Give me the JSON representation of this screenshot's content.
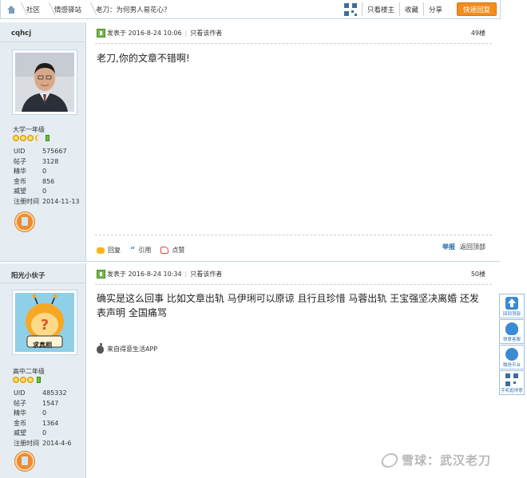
{
  "breadcrumb": {
    "items": [
      "社区",
      "情感驿站",
      "老刀：为何男人易花心？"
    ]
  },
  "toolbar": {
    "only_host": "只看楼主",
    "favorite": "收藏",
    "share": "分享",
    "quick_reply": "快速回复"
  },
  "posts": [
    {
      "username": "cqhcj",
      "level": "大学一年级",
      "stats": [
        {
          "k": "UID",
          "v": "575667"
        },
        {
          "k": "帖子",
          "v": "3128"
        },
        {
          "k": "精华",
          "v": "0"
        },
        {
          "k": "金币",
          "v": "856"
        },
        {
          "k": "威望",
          "v": "0"
        },
        {
          "k": "注册时间",
          "v": "2014-11-13"
        }
      ],
      "posted_label": "发表于",
      "posted_at": "2016-8-24 10:06",
      "only_author": "只看该作者",
      "floor": "49楼",
      "body": "老刀,你的文章不错啊!",
      "actions": {
        "reply": "回复",
        "quote": "引用",
        "like": "点赞"
      },
      "report": "举报",
      "back_top": "返回顶部"
    },
    {
      "username": "阳光小伙子",
      "avatar_text": "求真相",
      "level": "高中二年级",
      "stats": [
        {
          "k": "UID",
          "v": "485332"
        },
        {
          "k": "帖子",
          "v": "1547"
        },
        {
          "k": "精华",
          "v": "0"
        },
        {
          "k": "金币",
          "v": "1364"
        },
        {
          "k": "威望",
          "v": "0"
        },
        {
          "k": "注册时间",
          "v": "2014-4-6"
        }
      ],
      "posted_label": "发表于",
      "posted_at": "2016-8-24 10:34",
      "only_author": "只看该作者",
      "floor": "50楼",
      "body": "确实是这么回事 比如文章出轨 马伊琍可以原谅 且行且珍惜 马蓉出轨 王宝强坚决离婚 还发表声明 全国痛骂",
      "source": "来自得意生活APP"
    }
  ],
  "float_bar": [
    "回到顶部",
    "得意客服",
    "微信平台",
    "手机逛得意"
  ],
  "watermark": "雪球：武汉老刀",
  "colors": {
    "accent": "#f28c1e",
    "sidebar_bg": "#e5edf2",
    "border": "#c2d5e3",
    "link": "#2366a8"
  }
}
